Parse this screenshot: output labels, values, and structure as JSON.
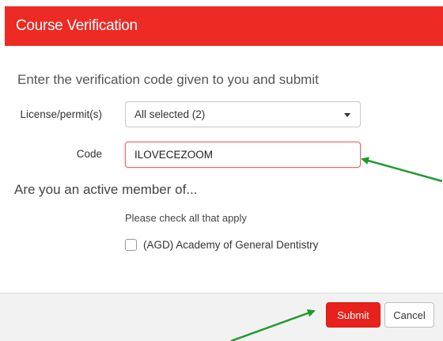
{
  "header": {
    "title": "Course Verification"
  },
  "form": {
    "instruction": "Enter the verification code given to you and submit",
    "license_label": "License/permit(s)",
    "license_value": "All selected (2)",
    "code_label": "Code",
    "code_value": "ILOVECEZOOM",
    "active_question": "Are you an active member of...",
    "check_hint": "Please check all that apply",
    "checkbox_label": "(AGD) Academy of General Dentistry",
    "checkbox_checked": false
  },
  "footer": {
    "submit_label": "Submit",
    "cancel_label": "Cancel"
  },
  "colors": {
    "header_red": "#ee2a24",
    "submit_red": "#e8211c",
    "annotation_arrow": "#1f9a2c"
  },
  "icons": {
    "select_caret": "caret-down-icon",
    "annotation_arrow": "arrow-icon"
  }
}
